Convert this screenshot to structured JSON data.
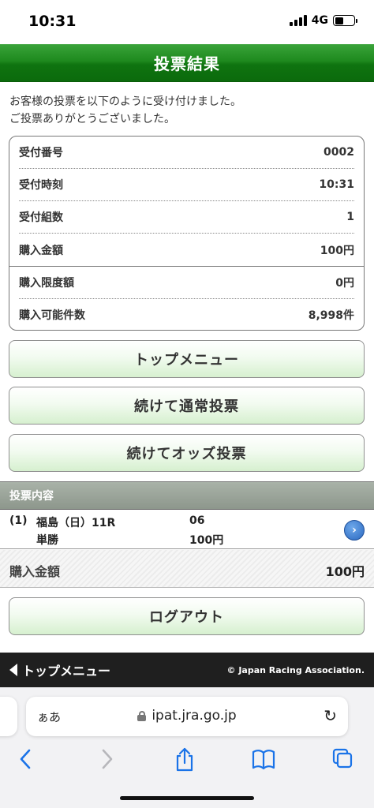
{
  "status_bar": {
    "time": "10:31",
    "network": "4G"
  },
  "header": {
    "title": "投票結果"
  },
  "intro": {
    "line1": "お客様の投票を以下のように受け付けました。",
    "line2": "ご投票ありがとうございました。"
  },
  "receipt": {
    "rows": [
      {
        "label": "受付番号",
        "value": "0002"
      },
      {
        "label": "受付時刻",
        "value": "10:31"
      },
      {
        "label": "受付組数",
        "value": "1"
      },
      {
        "label": "購入金額",
        "value": "100円"
      },
      {
        "label": "購入限度額",
        "value": "0円"
      },
      {
        "label": "購入可能件数",
        "value": "8,998件"
      }
    ]
  },
  "buttons": {
    "top_menu": "トップメニュー",
    "continue_normal": "続けて通常投票",
    "continue_odds": "続けてオッズ投票",
    "logout": "ログアウト"
  },
  "vote_contents": {
    "heading": "投票内容",
    "item": {
      "index": "(1)",
      "race": "福島（日）11R",
      "bet_type": "単勝",
      "horse": "06",
      "amount": "100円"
    }
  },
  "total": {
    "label": "購入金額",
    "value": "100円"
  },
  "footer": {
    "top_menu": "トップメニュー",
    "copyright": "© Japan Racing Association."
  },
  "browser": {
    "aa": "ぁあ",
    "url": "ipat.jra.go.jp"
  }
}
